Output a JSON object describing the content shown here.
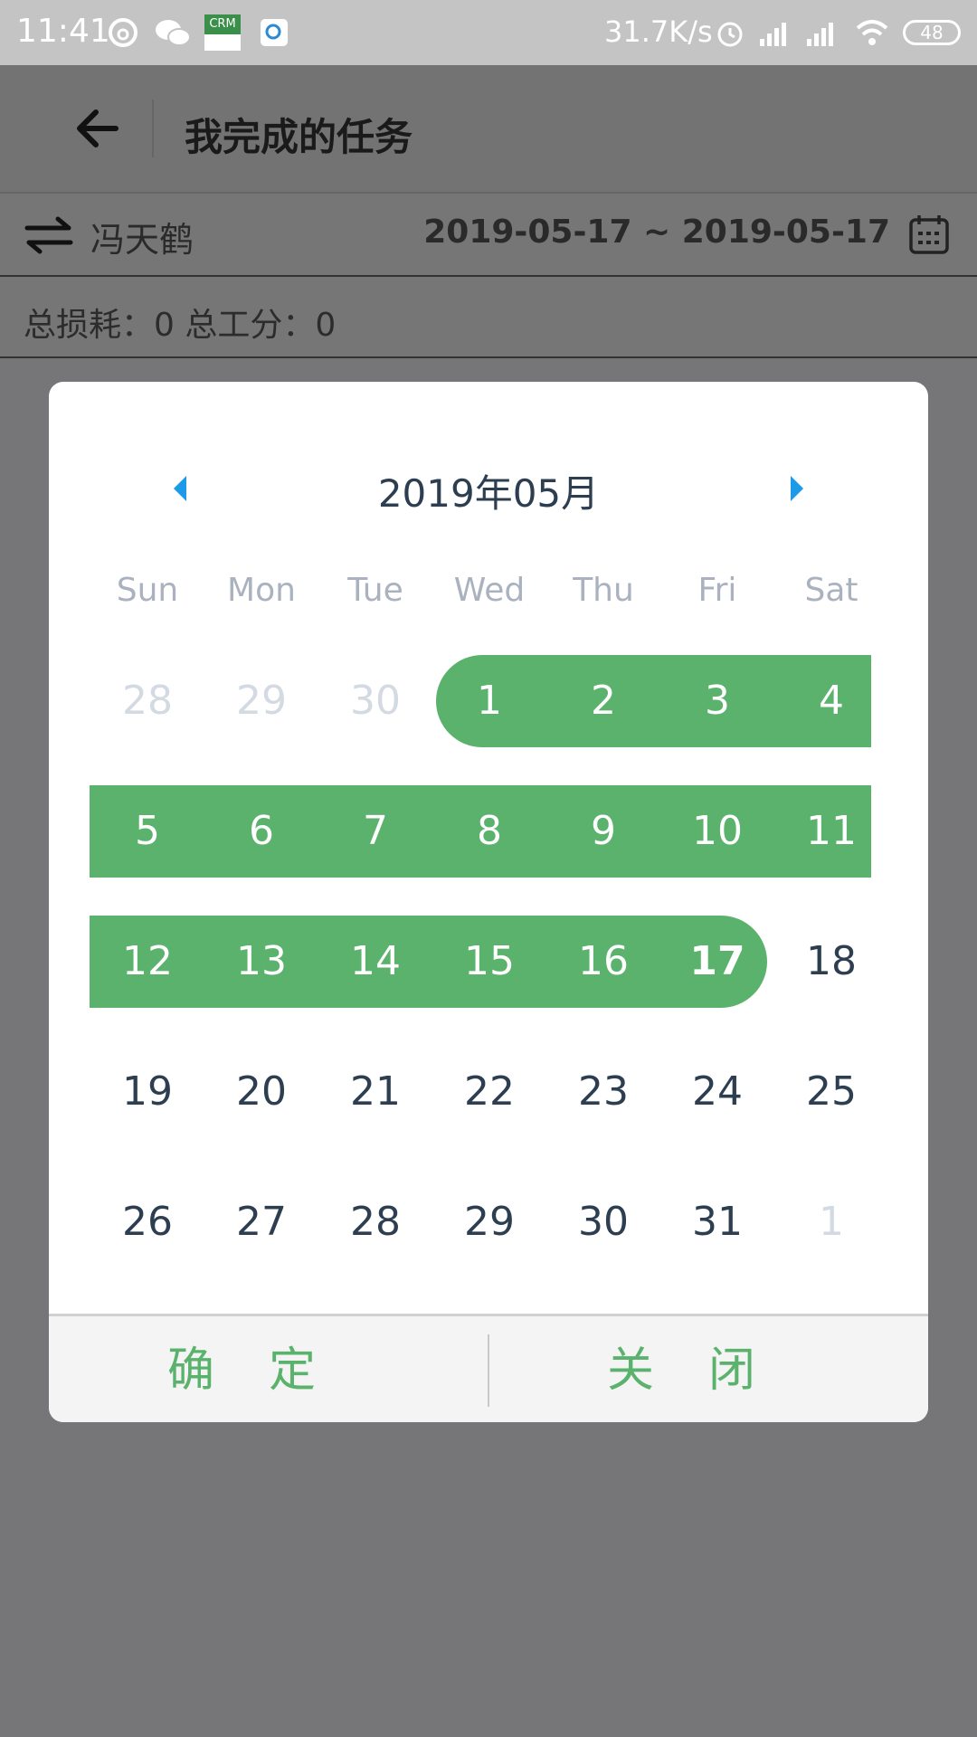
{
  "status_bar": {
    "time": "11:41",
    "network_speed": "31.7K/s",
    "battery": "48",
    "icons": [
      "netease-music-icon",
      "wechat-icon",
      "crm-app-icon",
      "qq-browser-icon",
      "alarm-icon",
      "signal-icon",
      "signal-icon",
      "wifi-icon",
      "battery-icon"
    ],
    "crm_label": "CRM"
  },
  "app_bar": {
    "title": "我完成的任务"
  },
  "filter": {
    "person": "冯天鹤",
    "date_range": "2019-05-17 ~ 2019-05-17"
  },
  "summary": {
    "text": "总损耗：0 总工分：0"
  },
  "calendar": {
    "month_title": "2019年05月",
    "weekdays": [
      "Sun",
      "Mon",
      "Tue",
      "Wed",
      "Thu",
      "Fri",
      "Sat"
    ],
    "weeks": [
      [
        "28",
        "29",
        "30",
        "1",
        "2",
        "3",
        "4"
      ],
      [
        "5",
        "6",
        "7",
        "8",
        "9",
        "10",
        "11"
      ],
      [
        "12",
        "13",
        "14",
        "15",
        "16",
        "17",
        "18"
      ],
      [
        "19",
        "20",
        "21",
        "22",
        "23",
        "24",
        "25"
      ],
      [
        "26",
        "27",
        "28",
        "29",
        "30",
        "31",
        "1"
      ]
    ],
    "selected_range": [
      "2019-05-01",
      "2019-05-17"
    ],
    "highlight_color": "#5bb26c"
  },
  "dialog_buttons": {
    "confirm": "确定",
    "close": "关闭"
  }
}
